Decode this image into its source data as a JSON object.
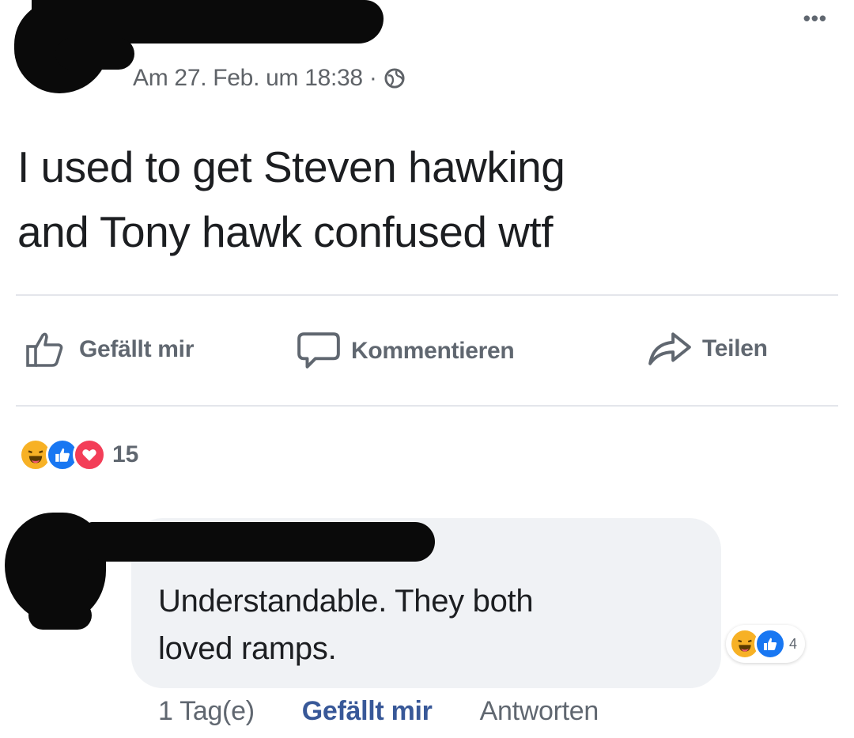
{
  "post": {
    "timestamp": "Am 27. Feb. um 18:38 ·",
    "text_line1": "I used to get Steven hawking",
    "text_line2": "and Tony hawk confused wtf",
    "more_icon": "more-options-icon"
  },
  "actions": {
    "like_label": "Gefällt mir",
    "comment_label": "Kommentieren",
    "share_label": "Teilen"
  },
  "reactions": {
    "types": [
      "haha",
      "like",
      "love"
    ],
    "count": "15"
  },
  "comment": {
    "text_line1": "Understandable. They both",
    "text_line2": "loved ramps.",
    "reactions": [
      "haha",
      "like"
    ],
    "reaction_count": "4",
    "time": "1 Tag(e)",
    "like_label": "Gefällt mir",
    "reply_label": "Antworten"
  },
  "colors": {
    "text": "#1c1e21",
    "muted": "#606770",
    "link": "#385898",
    "like_blue": "#1877f2",
    "love_red": "#f33e58",
    "haha_yellow": "#f7b125"
  }
}
